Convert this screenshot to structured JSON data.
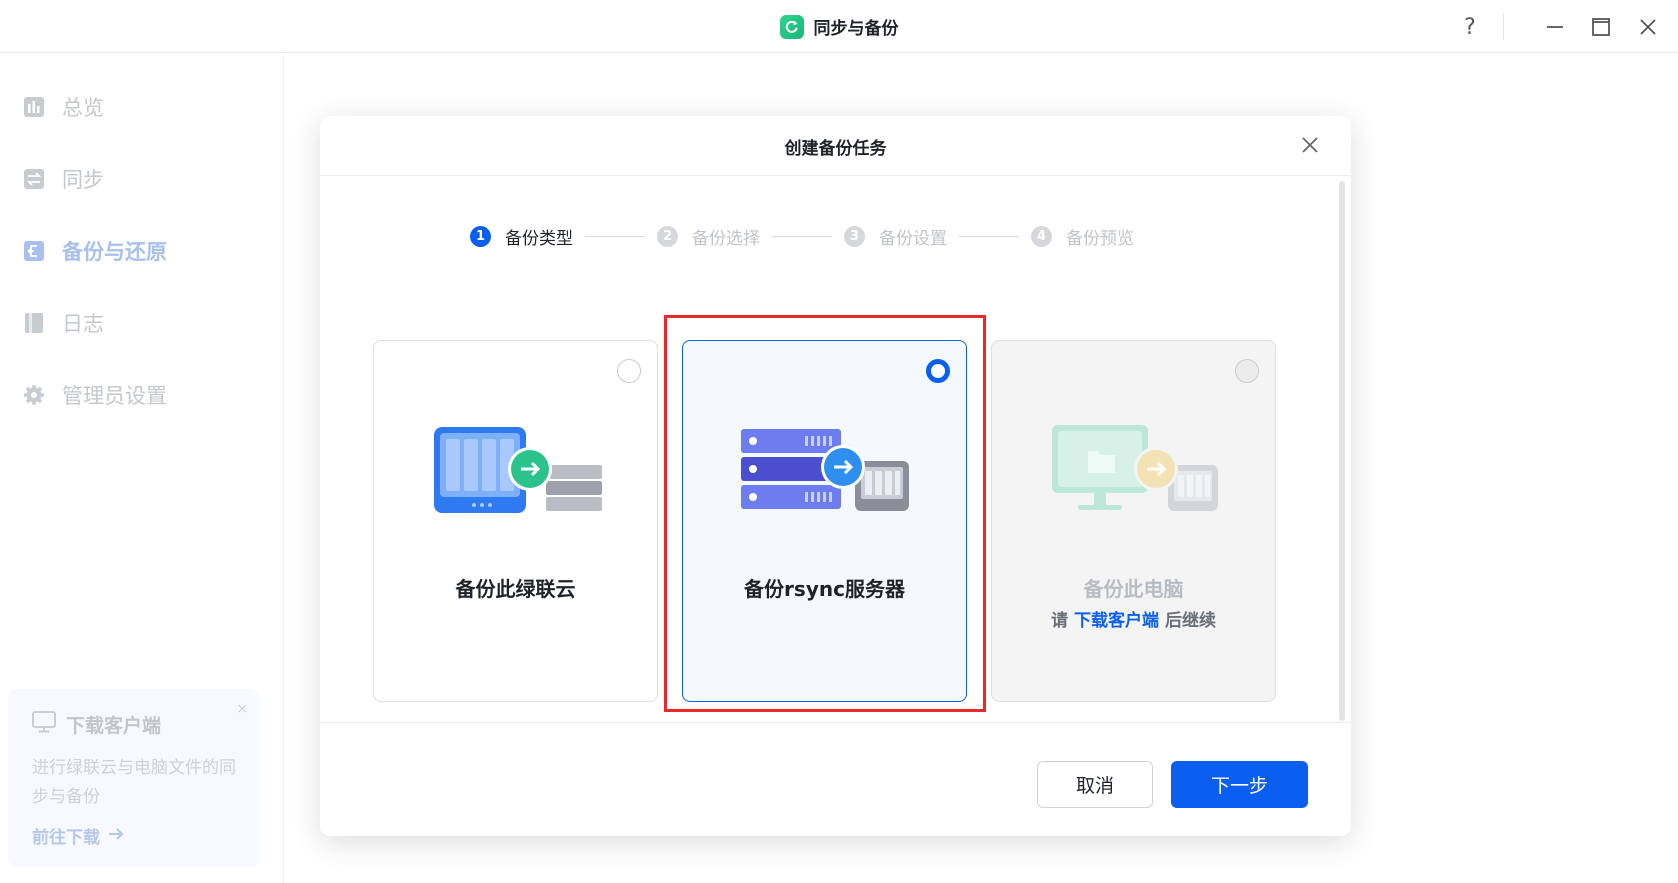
{
  "app": {
    "title": "同步与备份"
  },
  "window_controls": {
    "help": "?"
  },
  "sidebar": {
    "items": [
      {
        "label": "总览",
        "icon": "chart-icon",
        "active": false
      },
      {
        "label": "同步",
        "icon": "sync-icon",
        "active": false
      },
      {
        "label": "备份与还原",
        "icon": "backup-restore-icon",
        "active": true
      },
      {
        "label": "日志",
        "icon": "log-icon",
        "active": false
      },
      {
        "label": "管理员设置",
        "icon": "gear-icon",
        "active": false
      }
    ],
    "promo": {
      "title": "下载客户端",
      "description": "进行绿联云与电脑文件的同步与备份",
      "link": "前往下载",
      "close": "×"
    }
  },
  "dialog": {
    "title": "创建备份任务",
    "steps": [
      {
        "num": "1",
        "label": "备份类型",
        "active": true
      },
      {
        "num": "2",
        "label": "备份选择",
        "active": false
      },
      {
        "num": "3",
        "label": "备份设置",
        "active": false
      },
      {
        "num": "4",
        "label": "备份预览",
        "active": false
      }
    ],
    "options": [
      {
        "label": "备份此绿联云",
        "state": "unselected"
      },
      {
        "label": "备份rsync服务器",
        "state": "selected"
      },
      {
        "label": "备份此电脑",
        "state": "disabled",
        "sub_prefix": "请",
        "sub_link": "下载客户端",
        "sub_suffix": "后继续"
      }
    ],
    "buttons": {
      "cancel": "取消",
      "next": "下一步"
    }
  },
  "colors": {
    "accent": "#0b5ff0",
    "highlight": "#e82a2a",
    "brand": "#1fc283"
  }
}
